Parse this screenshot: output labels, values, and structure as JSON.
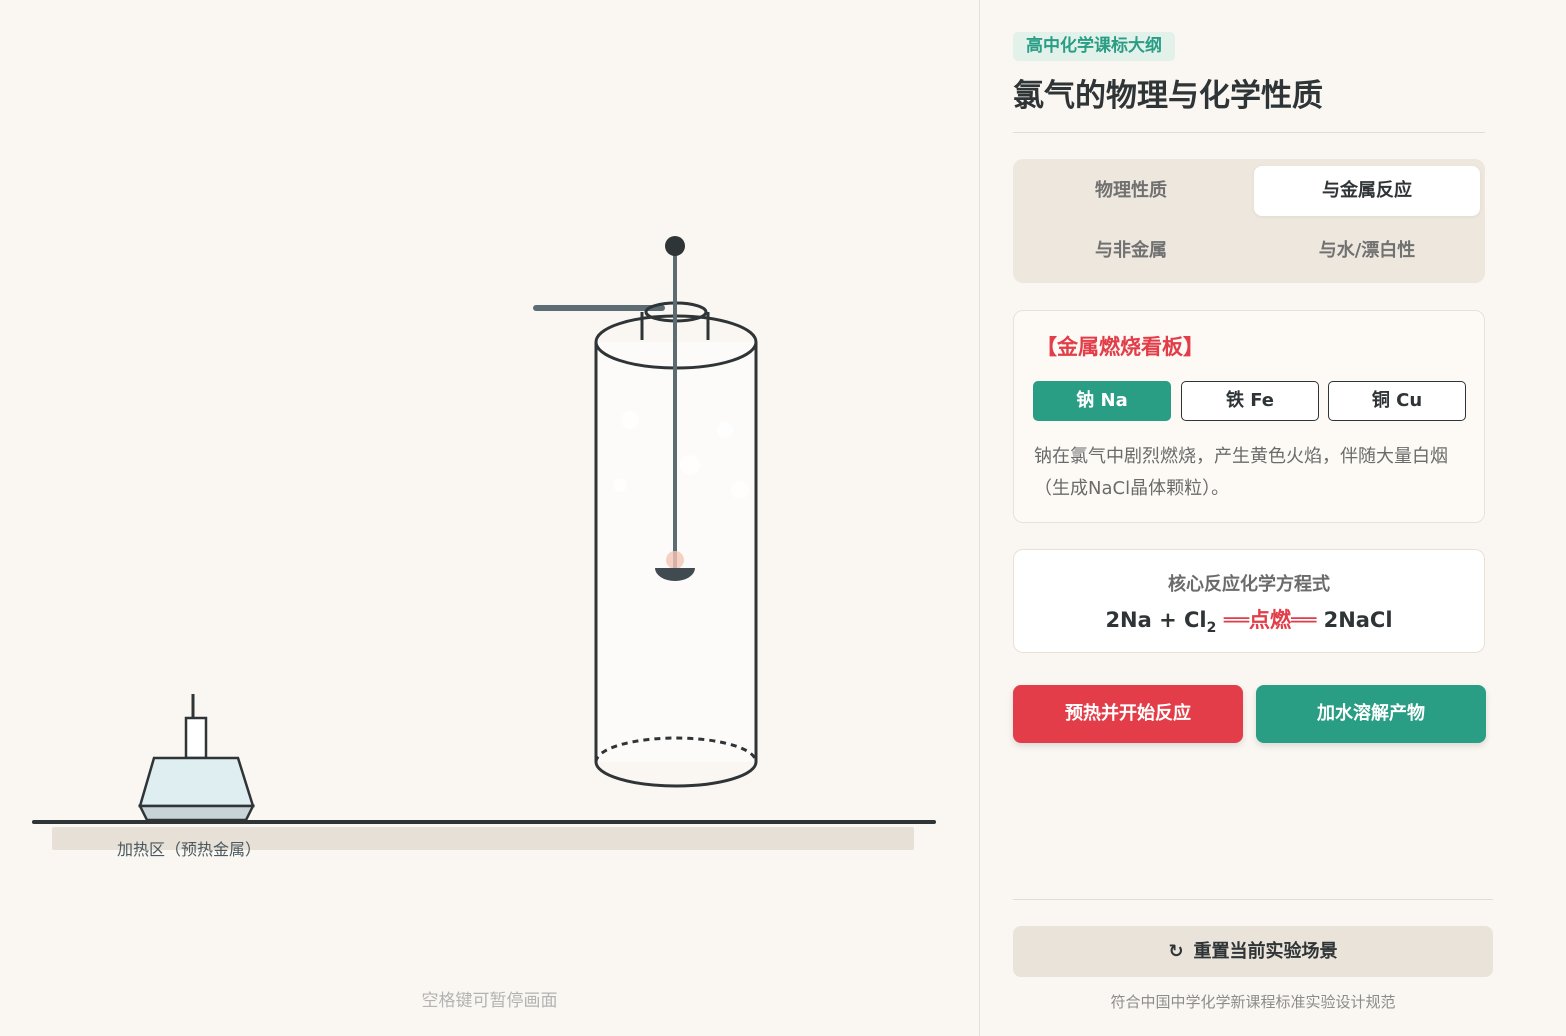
{
  "stage": {
    "heat_zone_label": "加热区（预热金属）",
    "hint": "空格键可暂停画面"
  },
  "panel": {
    "badge": "高中化学课标大纲",
    "title": "氯气的物理与化学性质",
    "tabs": [
      {
        "label": "物理性质",
        "active": false
      },
      {
        "label": "与金属反应",
        "active": true
      },
      {
        "label": "与非金属",
        "active": false
      },
      {
        "label": "与水/漂白性",
        "active": false
      }
    ],
    "metal_board": {
      "title": "【金属燃烧看板】",
      "metals": [
        {
          "label": "钠 Na",
          "active": true
        },
        {
          "label": "铁 Fe",
          "active": false
        },
        {
          "label": "铜 Cu",
          "active": false
        }
      ],
      "description": "钠在氯气中剧烈燃烧，产生黄色火焰，伴随大量白烟（生成NaCl晶体颗粒）。"
    },
    "equation": {
      "label": "核心反应化学方程式",
      "left": "2Na + Cl",
      "sub": "2",
      "condition": "══点燃══",
      "right": "2NaCl"
    },
    "actions": {
      "preheat": "预热并开始反应",
      "dissolve": "加水溶解产物"
    },
    "reset": {
      "icon": "reset-icon",
      "glyph": "↻",
      "label": "重置当前实验场景"
    },
    "footer": "符合中国中学化学新课程标准实验设计规范"
  },
  "colors": {
    "accent_green": "#2a9d85",
    "accent_red": "#e23d48",
    "background": "#faf7f2"
  }
}
